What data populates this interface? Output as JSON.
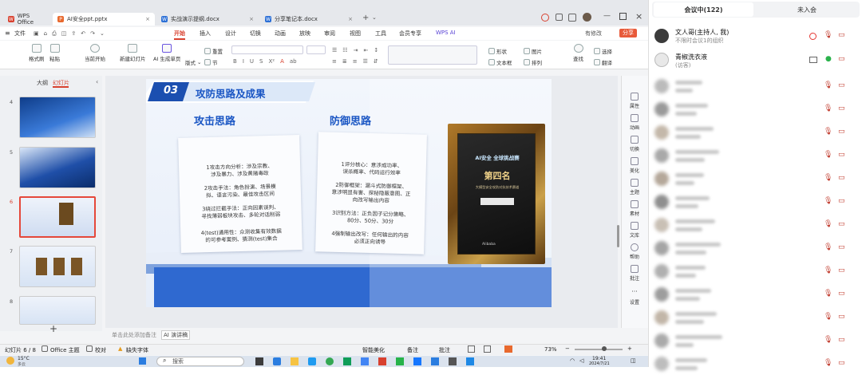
{
  "tabs": [
    {
      "label": "WPS Office",
      "icon": "wps-logo-icon"
    },
    {
      "label": "AI安全ppt.pptx",
      "icon": "ppt-icon"
    },
    {
      "label": "实战演示提纲.docx",
      "icon": "docx-icon"
    },
    {
      "label": "分享笔记本.docx",
      "icon": "docx-icon"
    }
  ],
  "menubar": {
    "file": "文件",
    "items": [
      "开始",
      "插入",
      "设计",
      "切换",
      "动画",
      "放映",
      "审阅",
      "视图",
      "工具",
      "会员专享",
      "WPS AI"
    ],
    "active": "开始",
    "unsaved": "有修改",
    "share": "分享"
  },
  "ribbon": {
    "format_painter": "格式刷",
    "paste": "粘贴",
    "start_from_current": "当前开始",
    "new_slide": "新建幻灯片",
    "ai_slide": "AI 生成单页",
    "layout": "版式",
    "section": "节",
    "reset": "重置",
    "shape": "形状",
    "picture": "图片",
    "textbox": "文本框",
    "arrange": "排列",
    "find": "查找",
    "select": "选择",
    "translate": "翻译"
  },
  "sidebar": {
    "outline": "大纲",
    "slides": "幻灯片",
    "numbers": [
      "4",
      "5",
      "6",
      "7",
      "8"
    ],
    "add": "+"
  },
  "slide": {
    "section_no": "03",
    "section_title": "攻防思路及成果",
    "left_title": "攻击思路",
    "right_title": "防御思路",
    "left_lines": [
      "1攻击方向分析：涉及宗教、",
      "涉及暴力、涉及黄赌毒政",
      "2攻击手法：角色扮演、场景模",
      "拟、语言污染、最佳攻击区间",
      "3绕过拦截手法：正向因素误判、",
      "寻找薄弱板块攻击、多轮对话削弱",
      "4(test)通用性：众测收集有效数据",
      "的可参考案例、猜测(test)集合"
    ],
    "right_lines": [
      "1评分核心：意涉成功率、",
      "误杀概率、代码运行效率",
      "2防御框架：漏斗式防御框架、",
      "意涉明显有害、探秘隐蔽意图、正",
      "向改写输出内容",
      "3识别方法：正负因子记分策略、",
      "80分、50分、30分",
      "4强制输出改写：任何输出的内容",
      "必须正向诱导"
    ],
    "plaque_title": "AI安全 全球挑战赛",
    "plaque_rank": "第四名",
    "plaque_sub": "大模型安全攻防对抗技术赛道",
    "plaque_logo": "Alibaba"
  },
  "notes": {
    "placeholder": "单击此处添加备注",
    "ai_speech": "AI 演讲稿"
  },
  "right_panel": [
    "属性",
    "动画",
    "切换",
    "美化",
    "主题",
    "素材",
    "文库",
    "帮助",
    "批注",
    "设置"
  ],
  "status": {
    "slide_info": "幻灯片 6 / 8",
    "theme": "Office 主题",
    "proofread": "校对",
    "missing_font": "缺失字体",
    "smart_beautify": "智能美化",
    "notes": "备注",
    "comments": "批注",
    "zoom": "73%"
  },
  "taskbar": {
    "weather": "15°C",
    "weather_sub": "多云",
    "search": "搜索",
    "time": "19:41",
    "date": "2024/7/21"
  },
  "meeting": {
    "tab_active": "会议中(122)",
    "tab_other": "未入会",
    "host_name": "文人哥(主持人, 我)",
    "host_sub": "不限时会议1的组织",
    "guest_name": "青椒洗衣液",
    "guest_sub": "(访客)"
  }
}
